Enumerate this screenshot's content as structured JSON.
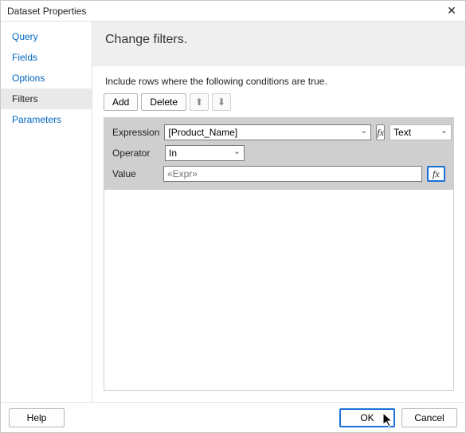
{
  "window": {
    "title": "Dataset Properties",
    "close_glyph": "✕"
  },
  "sidebar": {
    "items": [
      {
        "label": "Query"
      },
      {
        "label": "Fields"
      },
      {
        "label": "Options"
      },
      {
        "label": "Filters"
      },
      {
        "label": "Parameters"
      }
    ],
    "selected_index": 3
  },
  "page": {
    "heading": "Change filters.",
    "instruction": "Include rows where the following conditions are true.",
    "toolbar": {
      "add": "Add",
      "delete": "Delete",
      "move_up_glyph": "⬆",
      "move_down_glyph": "⬇"
    },
    "filter": {
      "expression_label": "Expression",
      "expression_value": "[Product_Name]",
      "type_label": "Text",
      "operator_label": "Operator",
      "operator_value": "In",
      "value_label": "Value",
      "value_placeholder": "«Expr»",
      "fx_label": "fx"
    }
  },
  "footer": {
    "help": "Help",
    "ok": "OK",
    "cancel": "Cancel"
  }
}
